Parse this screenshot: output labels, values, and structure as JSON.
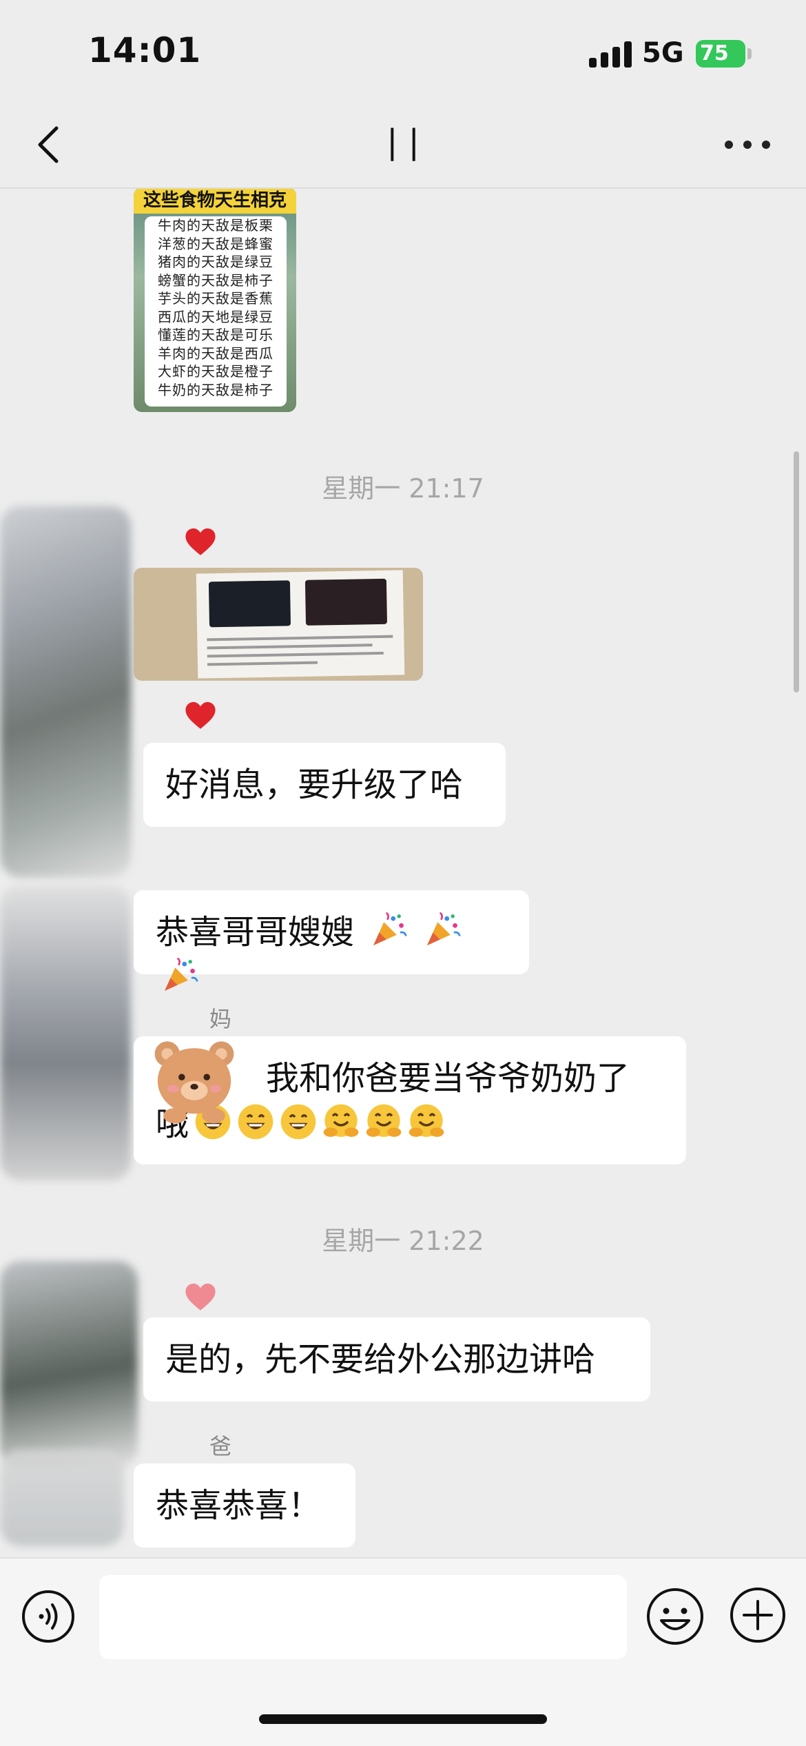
{
  "status_bar": {
    "time": "14:01",
    "network": "5G",
    "battery": "75"
  },
  "nav": {
    "title": "| |"
  },
  "messages": {
    "food_card": {
      "title": "这些食物天生相克",
      "lines": [
        "牛肉的天敌是板栗",
        "洋葱的天敌是蜂蜜",
        "猪肉的天敌是绿豆",
        "螃蟹的天敌是柿子",
        "芋头的天敌是香蕉",
        "西瓜的天地是绿豆",
        "懂莲的天敌是可乐",
        "羊肉的天敌是西瓜",
        "大虾的天敌是橙子",
        "牛奶的天敌是柿子"
      ]
    },
    "time_1": "星期一 21:17",
    "msg_good_news": "好消息，要升级了哈",
    "msg_congrats": "恭喜哥哥嫂嫂",
    "sender_mom": "妈",
    "msg_mom_line1": "我和你爸要当爷爷奶奶了",
    "msg_mom_line2": "哦",
    "time_2": "星期一 21:22",
    "msg_dont_tell": "是的，先不要给外公那边讲哈",
    "sender_dad": "爸",
    "msg_dad": "恭喜恭喜！"
  },
  "icons": {
    "back": "chevron-left-icon",
    "more": "ellipsis-icon",
    "voice": "voice-icon",
    "emoji": "emoji-icon",
    "plus": "plus-icon",
    "party": "party-popper-emoji",
    "grin": "grinning-face-emoji",
    "hug": "hugging-face-emoji",
    "heart": "heart-icon"
  },
  "colors": {
    "background": "#ededed",
    "bubble": "#ffffff",
    "battery": "#34c759",
    "heart": "#e0242b"
  }
}
